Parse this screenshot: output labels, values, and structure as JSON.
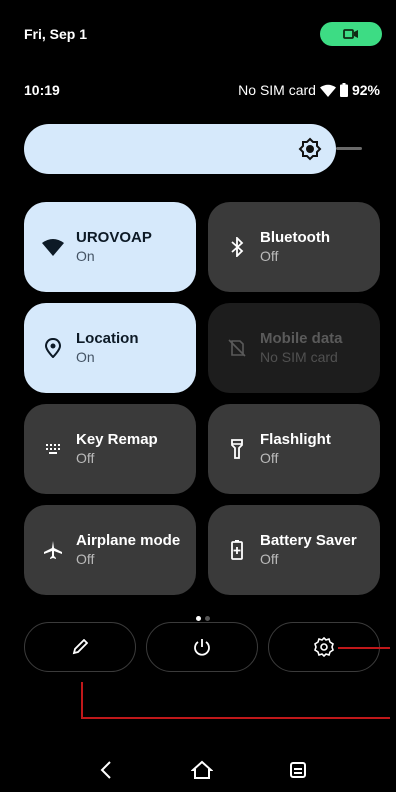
{
  "status": {
    "date": "Fri, Sep 1",
    "time": "10:19",
    "sim": "No SIM card",
    "battery_pct": "92%"
  },
  "brightness": {
    "icon": "brightness-icon"
  },
  "tiles": [
    {
      "title": "UROVOAP",
      "state": "On",
      "icon": "wifi-icon",
      "active": true
    },
    {
      "title": "Bluetooth",
      "state": "Off",
      "icon": "bluetooth-icon",
      "active": false
    },
    {
      "title": "Location",
      "state": "On",
      "icon": "location-icon",
      "active": true
    },
    {
      "title": "Mobile data",
      "state": "No SIM card",
      "icon": "mobile-data-off-icon",
      "active": false,
      "disabled": true
    },
    {
      "title": "Key Remap",
      "state": "Off",
      "icon": "keyboard-icon",
      "active": false
    },
    {
      "title": "Flashlight",
      "state": "Off",
      "icon": "flashlight-icon",
      "active": false
    },
    {
      "title": "Airplane mode",
      "state": "Off",
      "icon": "airplane-icon",
      "active": false
    },
    {
      "title": "Battery Saver",
      "state": "Off",
      "icon": "battery-saver-icon",
      "active": false
    }
  ],
  "page_indicator": {
    "current": 1,
    "total": 2
  },
  "bottom_actions": [
    "edit-icon",
    "power-icon",
    "settings-icon"
  ],
  "colors": {
    "accent_tile": "#d6e9fb",
    "inactive_tile": "#3a3a3a",
    "camera_pill": "#3ddc84",
    "annotation": "#c0181a"
  }
}
